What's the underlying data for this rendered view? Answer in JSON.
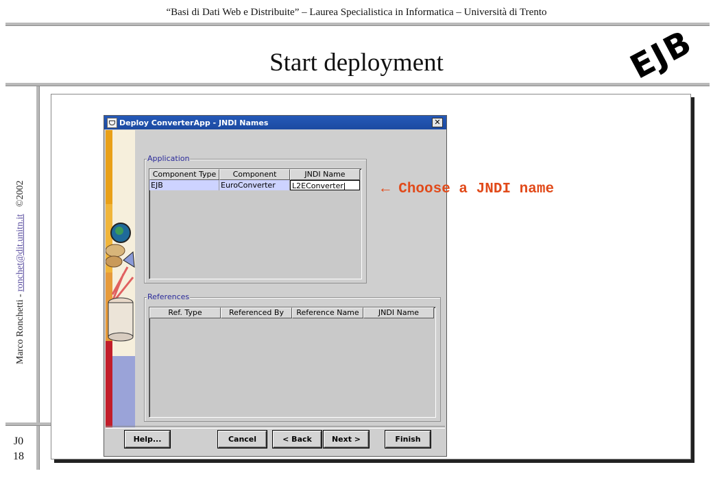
{
  "header": {
    "course_line": "“Basi di Dati Web e Distribuite” – Laurea Specialistica in Informatica – Università di Trento",
    "slide_title": "Start deployment",
    "logo_text": "EJB"
  },
  "sidebar": {
    "author": "Marco Ronchetti  -  ",
    "email": "ronchet@dit.unitn.it",
    "copyright": "©2002"
  },
  "footer": {
    "section": "J0",
    "page": "18"
  },
  "dialog": {
    "title": "Deploy ConverterApp - JNDI Names",
    "close_glyph": "✕",
    "application_label": "Application",
    "application_columns": [
      "Component Type",
      "Component",
      "JNDI Name"
    ],
    "application_rows": [
      {
        "type": "EJB",
        "component": "EuroConverter",
        "jndi": "L2EConverter"
      }
    ],
    "references_label": "References",
    "references_columns": [
      "Ref. Type",
      "Referenced By",
      "Reference Name",
      "JNDI Name"
    ],
    "buttons": {
      "help": "Help...",
      "cancel": "Cancel",
      "back": "< Back",
      "next": "Next >",
      "finish": "Finish"
    }
  },
  "annotation": {
    "arrow": "←",
    "text": "Choose a JNDI name",
    "color": "#e14a1a"
  },
  "colors": {
    "titlebar": "#1c4aa1",
    "selection": "#cdd3ff",
    "group_label": "#2a2a9a"
  }
}
